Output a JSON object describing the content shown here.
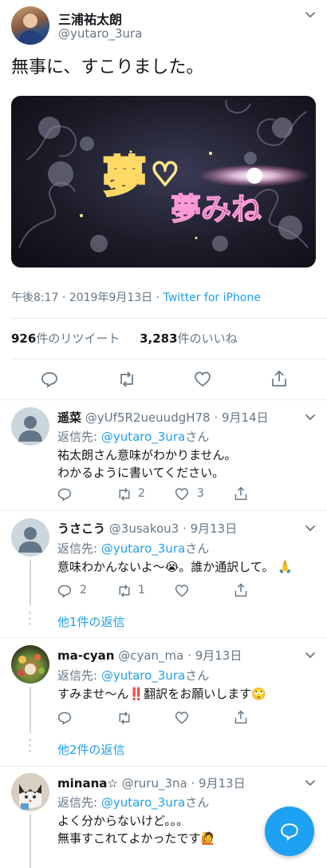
{
  "tweet": {
    "author_name": "三浦祐太朗",
    "author_handle": "@yutaro_3ura",
    "text": "無事に、すこりました。",
    "media_text": "夢みね",
    "time": "午後8:17",
    "date": "2019年9月13日",
    "separator": "·",
    "source": "Twitter for iPhone",
    "retweets_count": "926",
    "retweets_label": "件のリツイート",
    "likes_count": "3,283",
    "likes_label": "件のいいね"
  },
  "replies": [
    {
      "name": "遥菜",
      "handle": "@yUf5R2ueuudgH78",
      "date": "9月14日",
      "reply_to_prefix": "返信先: ",
      "reply_to": "@yutaro_3ura",
      "reply_to_suffix": "さん",
      "line1": "祐太朗さん意味がわかりません。",
      "line2": "わかるように書いてください。",
      "reply_count": "",
      "retweet_count": "2",
      "like_count": "3"
    },
    {
      "name": "うさこう",
      "handle": "@3usakou3",
      "date": "9月13日",
      "reply_to_prefix": "返信先: ",
      "reply_to": "@yutaro_3ura",
      "reply_to_suffix": "さん",
      "line1": "意味わかんないよ〜😭。誰か通訳して。 🙏",
      "reply_count": "2",
      "retweet_count": "1",
      "like_count": "",
      "more_replies": "他1件の返信"
    },
    {
      "name": "ma-cyan",
      "handle": "@cyan_ma",
      "date": "9月13日",
      "reply_to_prefix": "返信先: ",
      "reply_to": "@yutaro_3ura",
      "reply_to_suffix": "さん",
      "line1": "すみませ〜ん‼️翻訳をお願いします🙄",
      "reply_count": "",
      "retweet_count": "",
      "like_count": "",
      "more_replies": "他2件の返信"
    },
    {
      "name": "minana☆",
      "handle": "@ruru_3na",
      "date": "9月13日",
      "reply_to_prefix": "返信先: ",
      "reply_to": "@yutaro_3ura",
      "reply_to_suffix": "さん",
      "line1": "よく分からないけど。。。",
      "line2": "無事すこれてよかったです🙋"
    }
  ],
  "colors": {
    "accent": "#1da1f2",
    "muted": "#657786",
    "divider": "#e6ecf0"
  }
}
